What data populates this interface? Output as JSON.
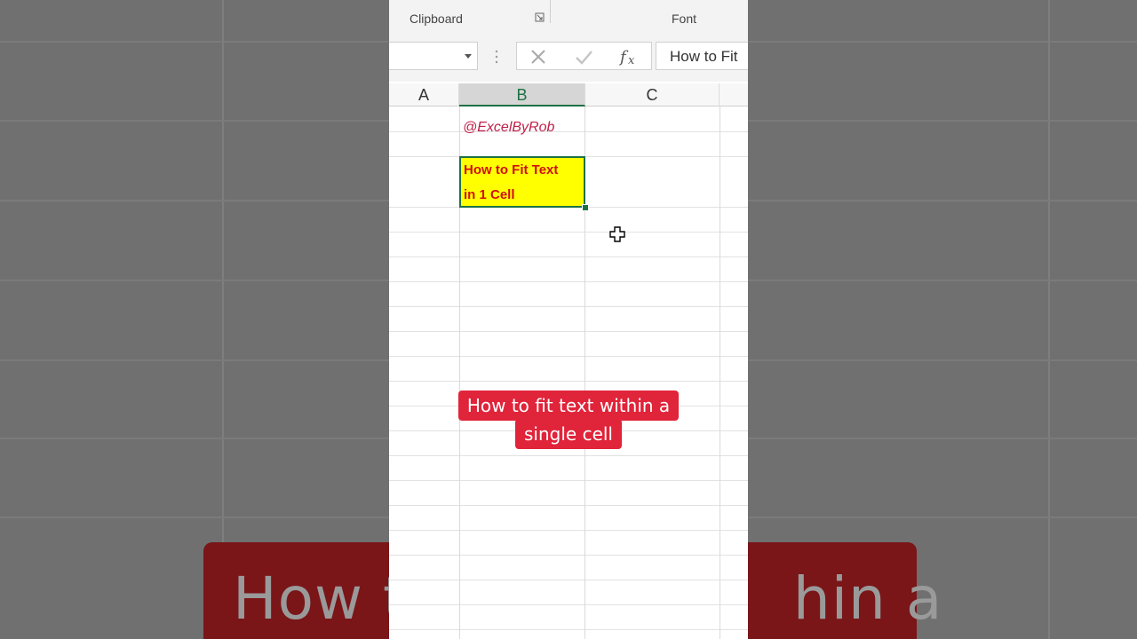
{
  "ribbon": {
    "group_clipboard": "Clipboard",
    "group_font": "Font"
  },
  "formula_bar": {
    "name_box_value": "",
    "formula_value": "How to Fit"
  },
  "columns": [
    {
      "label": "A"
    },
    {
      "label": "B"
    },
    {
      "label": "C"
    }
  ],
  "cells": {
    "b1": "@ExcelByRob",
    "b3_line1": "How to Fit Text",
    "b3_line2": "in 1 Cell"
  },
  "caption": {
    "line1": "How to fit text within a",
    "line2": "single cell"
  },
  "background": {
    "caption_left": "How t",
    "caption_right": "hin a"
  },
  "colors": {
    "accent_green": "#1e7145",
    "caption_red": "#e0243a",
    "cell_yellow": "#ffff00",
    "cell_text_red": "#d01010",
    "handle_pink": "#c0204a"
  },
  "icons": [
    "dialog-launcher-icon",
    "dropdown-arrow-icon",
    "cancel-x-icon",
    "enter-check-icon",
    "fx-function-icon",
    "plus-cursor-icon"
  ]
}
